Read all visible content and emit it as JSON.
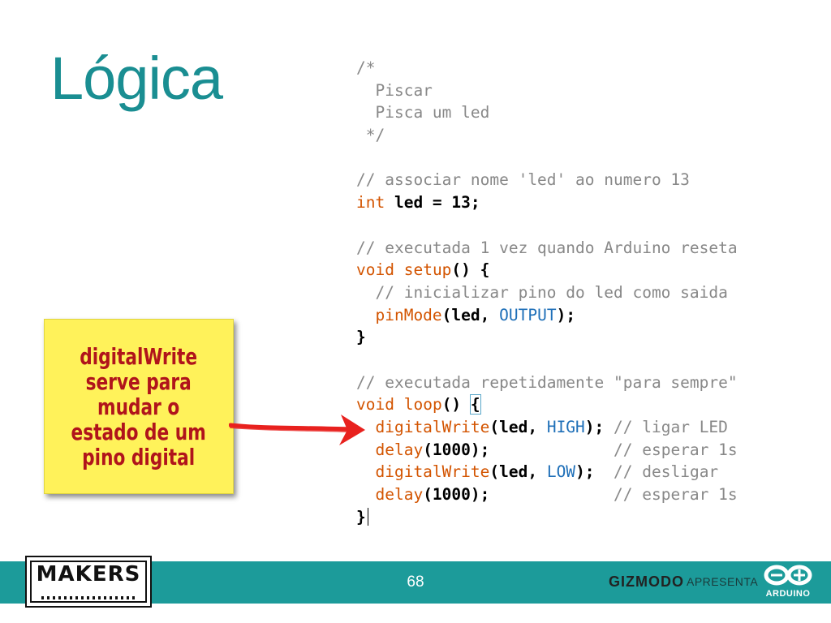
{
  "slide": {
    "title": "Lógica",
    "page_number": "68"
  },
  "code": {
    "lines": [
      [
        {
          "t": "/*",
          "c": "com"
        }
      ],
      [
        {
          "t": "  Piscar",
          "c": "com"
        }
      ],
      [
        {
          "t": "  Pisca um led",
          "c": "com"
        }
      ],
      [
        {
          "t": " */",
          "c": "com"
        }
      ],
      [
        {
          "t": "",
          "c": "txt"
        }
      ],
      [
        {
          "t": "// associar nome 'led' ao numero 13",
          "c": "com"
        }
      ],
      [
        {
          "t": "int",
          "c": "kw"
        },
        {
          "t": " led = 13;",
          "c": "txt"
        }
      ],
      [
        {
          "t": "",
          "c": "txt"
        }
      ],
      [
        {
          "t": "// executada 1 vez quando Arduino reseta",
          "c": "com"
        }
      ],
      [
        {
          "t": "void",
          "c": "kw"
        },
        {
          "t": " ",
          "c": "txt"
        },
        {
          "t": "setup",
          "c": "fn"
        },
        {
          "t": "() {",
          "c": "txt"
        }
      ],
      [
        {
          "t": "  // inicializar pino do led como saida",
          "c": "com"
        }
      ],
      [
        {
          "t": "  ",
          "c": "txt"
        },
        {
          "t": "pinMode",
          "c": "fn"
        },
        {
          "t": "(led, ",
          "c": "txt"
        },
        {
          "t": "OUTPUT",
          "c": "const"
        },
        {
          "t": ");",
          "c": "txt"
        }
      ],
      [
        {
          "t": "}",
          "c": "txt"
        }
      ],
      [
        {
          "t": "",
          "c": "txt"
        }
      ],
      [
        {
          "t": "// executada repetidamente \"para sempre\"",
          "c": "com"
        }
      ],
      [
        {
          "t": "void",
          "c": "kw"
        },
        {
          "t": " ",
          "c": "txt"
        },
        {
          "t": "loop",
          "c": "fn"
        },
        {
          "t": "() ",
          "c": "txt"
        },
        {
          "t": "{",
          "c": "hl"
        }
      ],
      [
        {
          "t": "  ",
          "c": "txt"
        },
        {
          "t": "digitalWrite",
          "c": "fn"
        },
        {
          "t": "(led, ",
          "c": "txt"
        },
        {
          "t": "HIGH",
          "c": "const"
        },
        {
          "t": "); ",
          "c": "txt"
        },
        {
          "t": "// ligar LED",
          "c": "com"
        }
      ],
      [
        {
          "t": "  ",
          "c": "txt"
        },
        {
          "t": "delay",
          "c": "fn"
        },
        {
          "t": "(1000);             ",
          "c": "txt"
        },
        {
          "t": "// esperar 1s",
          "c": "com"
        }
      ],
      [
        {
          "t": "  ",
          "c": "txt"
        },
        {
          "t": "digitalWrite",
          "c": "fn"
        },
        {
          "t": "(led, ",
          "c": "txt"
        },
        {
          "t": "LOW",
          "c": "const"
        },
        {
          "t": ");  ",
          "c": "txt"
        },
        {
          "t": "// desligar",
          "c": "com"
        }
      ],
      [
        {
          "t": "  ",
          "c": "txt"
        },
        {
          "t": "delay",
          "c": "fn"
        },
        {
          "t": "(1000);             ",
          "c": "txt"
        },
        {
          "t": "// esperar 1s",
          "c": "com"
        }
      ],
      [
        {
          "t": "}",
          "c": "txt"
        }
      ]
    ]
  },
  "note": {
    "lines": [
      "digitalWrite",
      "serve para",
      "mudar o",
      "estado de um",
      "pino digital"
    ]
  },
  "footer": {
    "makers_logo": "MAKERS",
    "gizmodo": "GIZMODO",
    "apresenta": "APRESENTA",
    "arduino_logo": "ARDUINO"
  },
  "colors": {
    "title": "#1a8e92",
    "footer_bar": "#1c9b9a",
    "note_bg": "#fff25a",
    "note_text": "#b0141b",
    "arrow": "#e8211e",
    "code_keyword": "#d35400",
    "code_constant": "#1e6fb8",
    "code_comment": "#888888"
  },
  "icons": {
    "arrow": "red-arrow-icon",
    "arduino": "arduino-infinity-icon"
  }
}
